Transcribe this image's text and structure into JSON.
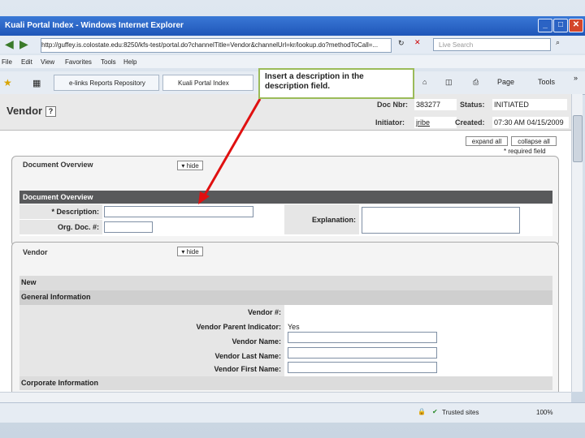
{
  "window": {
    "title": "Kuali Portal Index - Windows Internet Explorer"
  },
  "address_bar": {
    "url": "http://guffey.is.colostate.edu:8250/kfs-test/portal.do?channelTitle=Vendor&channelUrl=kr/lookup.do?methodToCall=...",
    "search_placeholder": "Live Search"
  },
  "menu": [
    "File",
    "Edit",
    "View",
    "Favorites",
    "Tools",
    "Help"
  ],
  "tabs": [
    {
      "label": "e-links Reports Repository"
    },
    {
      "label": "Kuali Portal Index"
    }
  ],
  "toolbar": {
    "page_label": "Page",
    "tools_label": "Tools"
  },
  "doc_header": {
    "title": "Vendor",
    "help_icon_text": "?",
    "doc_nbr_label": "Doc Nbr:",
    "doc_nbr": "383277",
    "status_label": "Status:",
    "status": "INITIATED",
    "initiator_label": "Initiator:",
    "initiator": "jribe",
    "created_label": "Created:",
    "created": "07:30 AM 04/15/2009"
  },
  "controls": {
    "expand_all": "expand all",
    "collapse_all": "collapse all",
    "required_note": "* required field"
  },
  "doc_overview": {
    "tab_label": "Document Overview",
    "hide_label": "hide",
    "section_title": "Document Overview",
    "description_label": "* Description:",
    "org_doc_label": "Org. Doc. #:",
    "explanation_label": "Explanation:"
  },
  "vendor": {
    "tab_label": "Vendor",
    "hide_label": "hide",
    "new_label": "New",
    "general_info": "General Information",
    "vendor_num_label": "Vendor #:",
    "parent_indicator_label": "Vendor Parent Indicator:",
    "parent_indicator_value": "Yes",
    "vendor_name_label": "Vendor Name:",
    "vendor_last_name_label": "Vendor Last Name:",
    "vendor_first_name_label": "Vendor First Name:",
    "corporate_info": "Corporate Information"
  },
  "callout": {
    "text": "Insert a description in the description field."
  },
  "status_bar": {
    "zone": "Trusted sites",
    "zoom": "100%"
  },
  "colors": {
    "callout_border": "#9bbb59",
    "arrow": "#e01010",
    "titlebar": "#2a63c6"
  }
}
